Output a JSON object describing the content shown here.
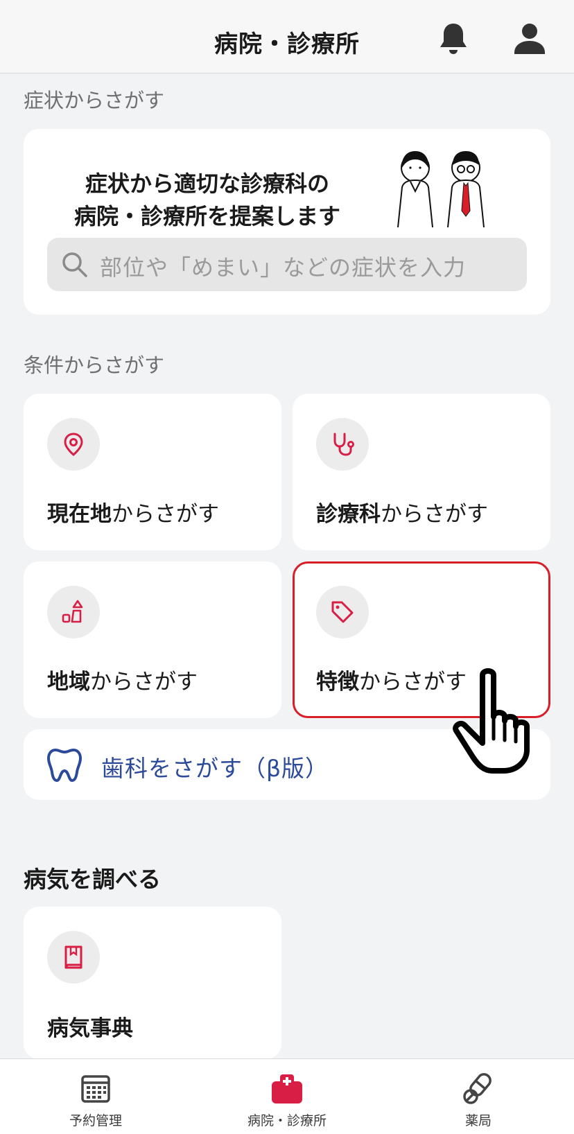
{
  "header": {
    "title": "病院・診療所"
  },
  "symptom_section": {
    "label": "症状からさがす",
    "headline_line1": "症状から適切な診療科の",
    "headline_line2": "病院・診療所を提案します",
    "search_placeholder": "部位や「めまい」などの症状を入力"
  },
  "condition_section": {
    "label": "条件からさがす",
    "cards": [
      {
        "bold": "現在地",
        "rest": "からさがす",
        "icon": "location-pin-icon"
      },
      {
        "bold": "診療科",
        "rest": "からさがす",
        "icon": "stethoscope-icon"
      },
      {
        "bold": "地域",
        "rest": "からさがす",
        "icon": "region-shapes-icon"
      },
      {
        "bold": "特徴",
        "rest": "からさがす",
        "icon": "tag-icon"
      }
    ],
    "dental_label": "歯科をさがす（β版）"
  },
  "disease_section": {
    "heading": "病気を調べる",
    "card_label": "病気事典"
  },
  "bottom_nav": {
    "items": [
      {
        "label": "予約管理",
        "icon": "calendar-icon"
      },
      {
        "label": "病院・診療所",
        "icon": "hospital-icon",
        "active": true
      },
      {
        "label": "薬局",
        "icon": "pill-icon"
      }
    ]
  },
  "colors": {
    "accent_red": "#d81e45",
    "highlight_border": "#d81e28",
    "dental_blue": "#2c4a9a",
    "background": "#f2f3f5"
  }
}
